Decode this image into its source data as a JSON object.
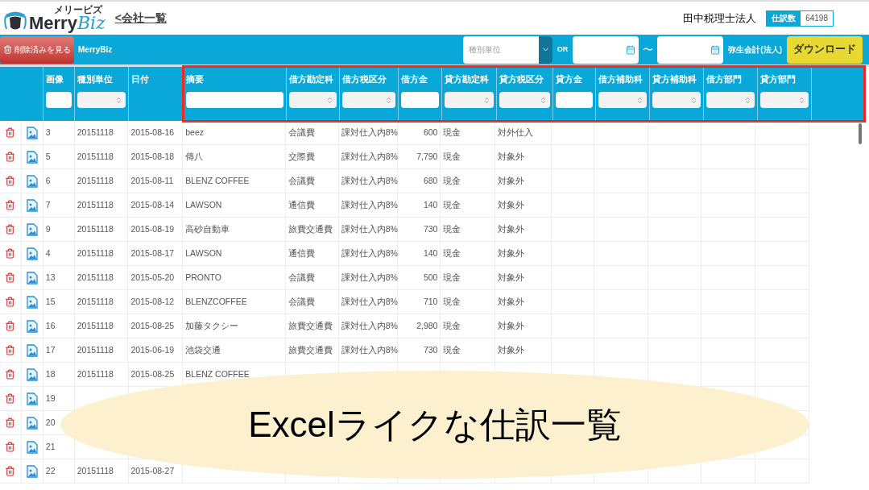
{
  "header": {
    "logo_small": "メリービズ",
    "logo_main": "Merry",
    "logo_script": "Biz",
    "back_link": "<会社一覧",
    "company": "田中税理士法人",
    "count_label": "仕訳数",
    "count_value": "64198"
  },
  "toolbar": {
    "deleted_button": "削除済みを見る",
    "client": "MerryBiz",
    "unit_placeholder": "種別単位",
    "or": "OR",
    "range_sep": "〜",
    "format": "弥生会計(法人)",
    "download": "ダウンロード"
  },
  "columns": [
    {
      "label": "画像",
      "kind": "text"
    },
    {
      "label": "種別単位",
      "kind": "select"
    },
    {
      "label": "日付",
      "kind": "none"
    },
    {
      "label": "摘要",
      "kind": "text"
    },
    {
      "label": "借方勘定科",
      "kind": "select"
    },
    {
      "label": "借方税区分",
      "kind": "select"
    },
    {
      "label": "借方金",
      "kind": "text"
    },
    {
      "label": "貸方勘定科",
      "kind": "select"
    },
    {
      "label": "貸方税区分",
      "kind": "select"
    },
    {
      "label": "貸方金",
      "kind": "text"
    },
    {
      "label": "借方補助科",
      "kind": "select"
    },
    {
      "label": "貸方補助科",
      "kind": "select"
    },
    {
      "label": "借方部門",
      "kind": "select"
    },
    {
      "label": "貸方部門",
      "kind": "select"
    }
  ],
  "rows": [
    {
      "cells": [
        "3",
        "20151118",
        "2015-08-16",
        "beez",
        "会議費",
        "課対仕入内8%",
        "600",
        "現金",
        "対外仕入"
      ]
    },
    {
      "cells": [
        "5",
        "20151118",
        "2015-08-18",
        "傳八",
        "交際費",
        "課対仕入内8%",
        "7,790",
        "現金",
        "対象外"
      ]
    },
    {
      "cells": [
        "6",
        "20151118",
        "2015-08-11",
        "BLENZ COFFEE",
        "会議費",
        "課対仕入内8%",
        "680",
        "現金",
        "対象外"
      ]
    },
    {
      "cells": [
        "7",
        "20151118",
        "2015-08-14",
        "LAWSON",
        "通信費",
        "課対仕入内8%",
        "140",
        "現金",
        "対象外"
      ]
    },
    {
      "cells": [
        "9",
        "20151118",
        "2015-08-19",
        "高砂自動車",
        "旅費交通費",
        "課対仕入内8%",
        "730",
        "現金",
        "対象外"
      ]
    },
    {
      "cells": [
        "4",
        "20151118",
        "2015-08-17",
        "LAWSON",
        "通信費",
        "課対仕入内8%",
        "140",
        "現金",
        "対象外"
      ]
    },
    {
      "cells": [
        "13",
        "20151118",
        "2015-05-20",
        "PRONTO",
        "会議費",
        "課対仕入内8%",
        "500",
        "現金",
        "対象外"
      ]
    },
    {
      "cells": [
        "15",
        "20151118",
        "2015-08-12",
        "BLENZCOFFEE",
        "会議費",
        "課対仕入内8%",
        "710",
        "現金",
        "対象外"
      ]
    },
    {
      "cells": [
        "16",
        "20151118",
        "2015-08-25",
        "加藤タクシー",
        "旅費交通費",
        "課対仕入内8%",
        "2,980",
        "現金",
        "対象外"
      ]
    },
    {
      "cells": [
        "17",
        "20151118",
        "2015-06-19",
        "池袋交通",
        "旅費交通費",
        "課対仕入内8%",
        "730",
        "現金",
        "対象外"
      ]
    },
    {
      "cells": [
        "18",
        "20151118",
        "2015-08-25",
        "BLENZ COFFEE"
      ]
    },
    {
      "cells": [
        "19"
      ]
    },
    {
      "cells": [
        "20"
      ]
    },
    {
      "cells": [
        "21"
      ]
    },
    {
      "cells": [
        "22",
        "20151118",
        "2015-08-27"
      ]
    }
  ],
  "caption": "Excelライクな仕訳一覧"
}
